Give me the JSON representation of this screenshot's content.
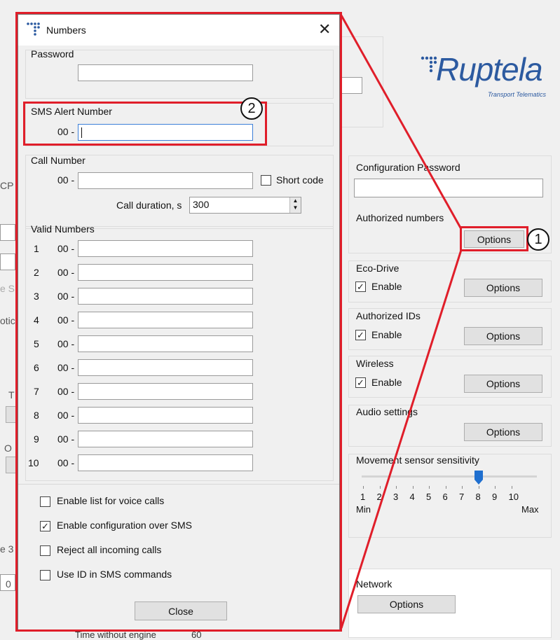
{
  "dialog": {
    "title": "Numbers",
    "password_label": "Password",
    "sms_alert_label": "SMS Alert Number",
    "sms_prefix": "00 -",
    "call_number_label": "Call Number",
    "call_prefix": "00 -",
    "short_code_label": "Short code",
    "call_duration_label": "Call duration, s",
    "call_duration_value": "300",
    "valid_numbers_label": "Valid Numbers",
    "valid_numbers": [
      {
        "index": "1",
        "prefix": "00 -"
      },
      {
        "index": "2",
        "prefix": "00 -"
      },
      {
        "index": "3",
        "prefix": "00 -"
      },
      {
        "index": "4",
        "prefix": "00 -"
      },
      {
        "index": "5",
        "prefix": "00 -"
      },
      {
        "index": "6",
        "prefix": "00 -"
      },
      {
        "index": "7",
        "prefix": "00 -"
      },
      {
        "index": "8",
        "prefix": "00 -"
      },
      {
        "index": "9",
        "prefix": "00 -"
      },
      {
        "index": "10",
        "prefix": "00 -"
      }
    ],
    "options": [
      {
        "label": "Enable list for voice calls",
        "checked": false
      },
      {
        "label": "Enable configuration over SMS",
        "checked": true
      },
      {
        "label": "Reject all incoming calls",
        "checked": false
      },
      {
        "label": "Use ID in SMS commands",
        "checked": false
      }
    ],
    "close_label": "Close"
  },
  "brand": {
    "logo_text": "Ruptela",
    "tagline": "Transport Telematics"
  },
  "right_panel": {
    "config_password_label": "Configuration Password",
    "authorized_numbers_label": "Authorized numbers",
    "authorized_numbers_button": "Options",
    "eco_drive_label": "Eco-Drive",
    "eco_drive_enable": "Enable",
    "eco_drive_button": "Options",
    "authorized_ids_label": "Authorized IDs",
    "authorized_ids_enable": "Enable",
    "authorized_ids_button": "Options",
    "wireless_label": "Wireless",
    "wireless_enable": "Enable",
    "wireless_button": "Options",
    "audio_label": "Audio settings",
    "audio_button": "Options",
    "movement_label": "Movement sensor sensitivity",
    "movement_ticks": [
      "1",
      "2",
      "3",
      "4",
      "5",
      "6",
      "7",
      "8",
      "9",
      "10"
    ],
    "movement_value": 8,
    "movement_min": "Min",
    "movement_max": "Max",
    "network_label": "Network",
    "network_button": "Options"
  },
  "background_fragments": {
    "cp": "CP",
    "s": "e S",
    "otic": "otic",
    "t": "T",
    "o": "O",
    "e3": "e 3",
    "zero": "0",
    "time_without_engine": "Time without engine",
    "sixty": "60"
  },
  "callouts": {
    "one": "1",
    "two": "2"
  },
  "colors": {
    "highlight": "#e01e2a",
    "logo_blue": "#2c5aa0",
    "slider_thumb": "#1f6fcf"
  }
}
